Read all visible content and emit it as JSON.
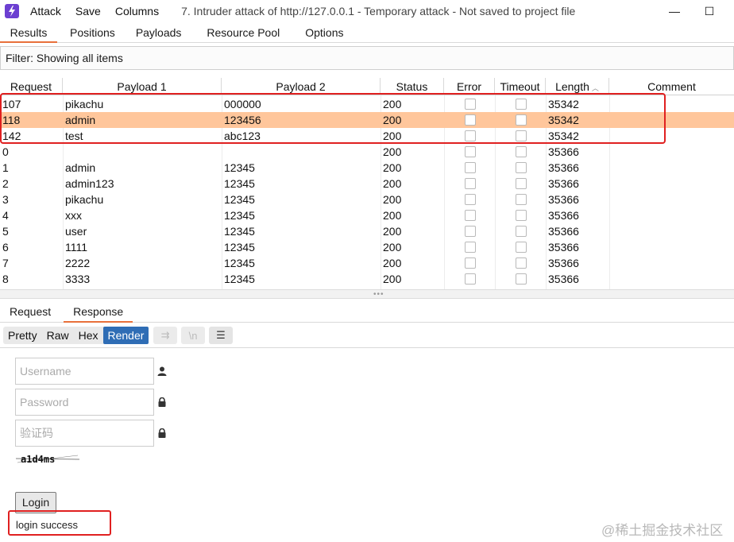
{
  "titlebar": {
    "menu": [
      "Attack",
      "Save",
      "Columns"
    ],
    "title": "7. Intruder attack of http://127.0.0.1 - Temporary attack - Not saved to project file",
    "minimize": "—",
    "maximize": "☐"
  },
  "tabs": [
    "Results",
    "Positions",
    "Payloads",
    "Resource Pool",
    "Options"
  ],
  "filter": "Filter: Showing all items",
  "table": {
    "headers": [
      "Request",
      "Payload 1",
      "Payload 2",
      "Status",
      "Error",
      "Timeout",
      "Length",
      "Comment"
    ],
    "sort_column": "Length",
    "rows": [
      {
        "request": "107",
        "p1": "pikachu",
        "p2": "000000",
        "status": "200",
        "length": "35342"
      },
      {
        "request": "118",
        "p1": "admin",
        "p2": "123456",
        "status": "200",
        "length": "35342"
      },
      {
        "request": "142",
        "p1": "test",
        "p2": "abc123",
        "status": "200",
        "length": "35342"
      },
      {
        "request": "0",
        "p1": "",
        "p2": "",
        "status": "200",
        "length": "35366"
      },
      {
        "request": "1",
        "p1": "admin",
        "p2": "12345",
        "status": "200",
        "length": "35366"
      },
      {
        "request": "2",
        "p1": "admin123",
        "p2": "12345",
        "status": "200",
        "length": "35366"
      },
      {
        "request": "3",
        "p1": "pikachu",
        "p2": "12345",
        "status": "200",
        "length": "35366"
      },
      {
        "request": "4",
        "p1": "xxx",
        "p2": "12345",
        "status": "200",
        "length": "35366"
      },
      {
        "request": "5",
        "p1": "user",
        "p2": "12345",
        "status": "200",
        "length": "35366"
      },
      {
        "request": "6",
        "p1": "1111",
        "p2": "12345",
        "status": "200",
        "length": "35366"
      },
      {
        "request": "7",
        "p1": "2222",
        "p2": "12345",
        "status": "200",
        "length": "35366"
      },
      {
        "request": "8",
        "p1": "3333",
        "p2": "12345",
        "status": "200",
        "length": "35366"
      }
    ]
  },
  "rr_tabs": [
    "Request",
    "Response"
  ],
  "view_modes": [
    "Pretty",
    "Raw",
    "Hex",
    "Render"
  ],
  "view_tools": [
    "wrap-lines-icon",
    "newline-icon",
    "menu-icon"
  ],
  "view_tool_glyphs": [
    "⇉",
    "\\n",
    "☰"
  ],
  "render": {
    "username_placeholder": "Username",
    "password_placeholder": "Password",
    "captcha_placeholder": "验证码",
    "captcha_text": "a1d4ms",
    "login_label": "Login",
    "result": "login success"
  },
  "watermark": "@稀土掘金技术社区",
  "colors": {
    "selected_row": "#ffc69b",
    "accent_tab": "#e8703a",
    "render_active": "#2f6db5",
    "highlight_box": "#e02020"
  }
}
